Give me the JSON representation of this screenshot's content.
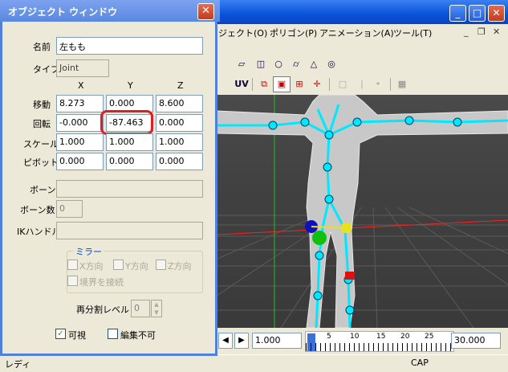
{
  "main_window": {
    "menus": [
      "ジェクト(O)",
      "ポリゴン(P)",
      "アニメーション(A)",
      "ツール(T)"
    ],
    "toolbar2_uv": "UV"
  },
  "object_window": {
    "title": "オブジェクト ウィンドウ",
    "name_label": "名前",
    "name_value": "左もも",
    "type_label": "タイプ",
    "type_value": "Joint",
    "col_x": "X",
    "col_y": "Y",
    "col_z": "Z",
    "move_label": "移動",
    "move": [
      "8.273",
      "0.000",
      "8.600"
    ],
    "rotate_label": "回転",
    "rotate": [
      "-0.000",
      "-87.463",
      "0.000"
    ],
    "scale_label": "スケール",
    "scale": [
      "1.000",
      "1.000",
      "1.000"
    ],
    "pivot_label": "ピボット",
    "pivot": [
      "0.000",
      "0.000",
      "0.000"
    ],
    "bone_label": "ボーン",
    "bone_count_label": "ボーン数",
    "bone_count_value": "0",
    "ik_label": "IKハンドル",
    "mirror_label": "ミラー",
    "mirror_x": "X方向",
    "mirror_y": "Y方向",
    "mirror_z": "Z方向",
    "mirror_connect": "境界を接続",
    "subdiv_label": "再分割レベル",
    "subdiv_value": "0",
    "visible_label": "可視",
    "visible_checked": true,
    "locked_label": "編集不可",
    "locked_checked": false
  },
  "timeline": {
    "start_value": "1.000",
    "end_value": "30.000",
    "ticks": [
      "5",
      "10",
      "15",
      "20",
      "25"
    ]
  },
  "statusbar": {
    "left": "レディ",
    "cap": "CAP"
  },
  "colors": {
    "viewport_bg": "#404040",
    "bone": "#00e8ff",
    "highlight": "#e02020"
  }
}
